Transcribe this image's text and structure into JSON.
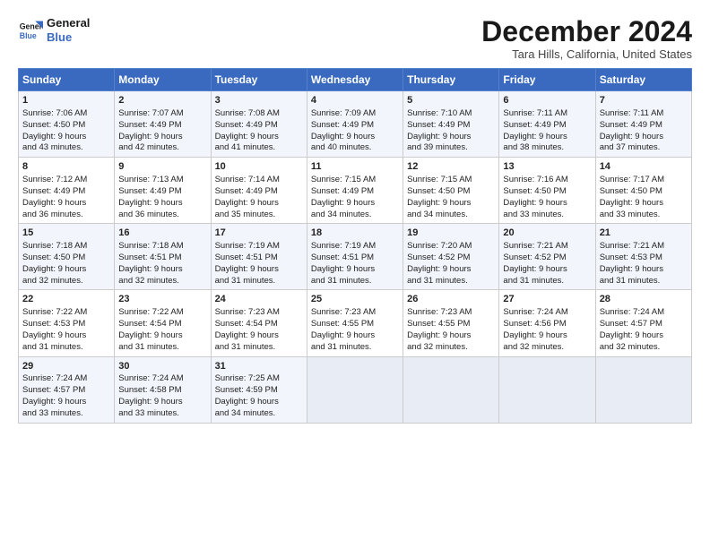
{
  "header": {
    "logo_line1": "General",
    "logo_line2": "Blue",
    "title": "December 2024",
    "subtitle": "Tara Hills, California, United States"
  },
  "days_of_week": [
    "Sunday",
    "Monday",
    "Tuesday",
    "Wednesday",
    "Thursday",
    "Friday",
    "Saturday"
  ],
  "weeks": [
    [
      {
        "day": "1",
        "lines": [
          "Sunrise: 7:06 AM",
          "Sunset: 4:50 PM",
          "Daylight: 9 hours",
          "and 43 minutes."
        ]
      },
      {
        "day": "2",
        "lines": [
          "Sunrise: 7:07 AM",
          "Sunset: 4:49 PM",
          "Daylight: 9 hours",
          "and 42 minutes."
        ]
      },
      {
        "day": "3",
        "lines": [
          "Sunrise: 7:08 AM",
          "Sunset: 4:49 PM",
          "Daylight: 9 hours",
          "and 41 minutes."
        ]
      },
      {
        "day": "4",
        "lines": [
          "Sunrise: 7:09 AM",
          "Sunset: 4:49 PM",
          "Daylight: 9 hours",
          "and 40 minutes."
        ]
      },
      {
        "day": "5",
        "lines": [
          "Sunrise: 7:10 AM",
          "Sunset: 4:49 PM",
          "Daylight: 9 hours",
          "and 39 minutes."
        ]
      },
      {
        "day": "6",
        "lines": [
          "Sunrise: 7:11 AM",
          "Sunset: 4:49 PM",
          "Daylight: 9 hours",
          "and 38 minutes."
        ]
      },
      {
        "day": "7",
        "lines": [
          "Sunrise: 7:11 AM",
          "Sunset: 4:49 PM",
          "Daylight: 9 hours",
          "and 37 minutes."
        ]
      }
    ],
    [
      {
        "day": "8",
        "lines": [
          "Sunrise: 7:12 AM",
          "Sunset: 4:49 PM",
          "Daylight: 9 hours",
          "and 36 minutes."
        ]
      },
      {
        "day": "9",
        "lines": [
          "Sunrise: 7:13 AM",
          "Sunset: 4:49 PM",
          "Daylight: 9 hours",
          "and 36 minutes."
        ]
      },
      {
        "day": "10",
        "lines": [
          "Sunrise: 7:14 AM",
          "Sunset: 4:49 PM",
          "Daylight: 9 hours",
          "and 35 minutes."
        ]
      },
      {
        "day": "11",
        "lines": [
          "Sunrise: 7:15 AM",
          "Sunset: 4:49 PM",
          "Daylight: 9 hours",
          "and 34 minutes."
        ]
      },
      {
        "day": "12",
        "lines": [
          "Sunrise: 7:15 AM",
          "Sunset: 4:50 PM",
          "Daylight: 9 hours",
          "and 34 minutes."
        ]
      },
      {
        "day": "13",
        "lines": [
          "Sunrise: 7:16 AM",
          "Sunset: 4:50 PM",
          "Daylight: 9 hours",
          "and 33 minutes."
        ]
      },
      {
        "day": "14",
        "lines": [
          "Sunrise: 7:17 AM",
          "Sunset: 4:50 PM",
          "Daylight: 9 hours",
          "and 33 minutes."
        ]
      }
    ],
    [
      {
        "day": "15",
        "lines": [
          "Sunrise: 7:18 AM",
          "Sunset: 4:50 PM",
          "Daylight: 9 hours",
          "and 32 minutes."
        ]
      },
      {
        "day": "16",
        "lines": [
          "Sunrise: 7:18 AM",
          "Sunset: 4:51 PM",
          "Daylight: 9 hours",
          "and 32 minutes."
        ]
      },
      {
        "day": "17",
        "lines": [
          "Sunrise: 7:19 AM",
          "Sunset: 4:51 PM",
          "Daylight: 9 hours",
          "and 31 minutes."
        ]
      },
      {
        "day": "18",
        "lines": [
          "Sunrise: 7:19 AM",
          "Sunset: 4:51 PM",
          "Daylight: 9 hours",
          "and 31 minutes."
        ]
      },
      {
        "day": "19",
        "lines": [
          "Sunrise: 7:20 AM",
          "Sunset: 4:52 PM",
          "Daylight: 9 hours",
          "and 31 minutes."
        ]
      },
      {
        "day": "20",
        "lines": [
          "Sunrise: 7:21 AM",
          "Sunset: 4:52 PM",
          "Daylight: 9 hours",
          "and 31 minutes."
        ]
      },
      {
        "day": "21",
        "lines": [
          "Sunrise: 7:21 AM",
          "Sunset: 4:53 PM",
          "Daylight: 9 hours",
          "and 31 minutes."
        ]
      }
    ],
    [
      {
        "day": "22",
        "lines": [
          "Sunrise: 7:22 AM",
          "Sunset: 4:53 PM",
          "Daylight: 9 hours",
          "and 31 minutes."
        ]
      },
      {
        "day": "23",
        "lines": [
          "Sunrise: 7:22 AM",
          "Sunset: 4:54 PM",
          "Daylight: 9 hours",
          "and 31 minutes."
        ]
      },
      {
        "day": "24",
        "lines": [
          "Sunrise: 7:23 AM",
          "Sunset: 4:54 PM",
          "Daylight: 9 hours",
          "and 31 minutes."
        ]
      },
      {
        "day": "25",
        "lines": [
          "Sunrise: 7:23 AM",
          "Sunset: 4:55 PM",
          "Daylight: 9 hours",
          "and 31 minutes."
        ]
      },
      {
        "day": "26",
        "lines": [
          "Sunrise: 7:23 AM",
          "Sunset: 4:55 PM",
          "Daylight: 9 hours",
          "and 32 minutes."
        ]
      },
      {
        "day": "27",
        "lines": [
          "Sunrise: 7:24 AM",
          "Sunset: 4:56 PM",
          "Daylight: 9 hours",
          "and 32 minutes."
        ]
      },
      {
        "day": "28",
        "lines": [
          "Sunrise: 7:24 AM",
          "Sunset: 4:57 PM",
          "Daylight: 9 hours",
          "and 32 minutes."
        ]
      }
    ],
    [
      {
        "day": "29",
        "lines": [
          "Sunrise: 7:24 AM",
          "Sunset: 4:57 PM",
          "Daylight: 9 hours",
          "and 33 minutes."
        ]
      },
      {
        "day": "30",
        "lines": [
          "Sunrise: 7:24 AM",
          "Sunset: 4:58 PM",
          "Daylight: 9 hours",
          "and 33 minutes."
        ]
      },
      {
        "day": "31",
        "lines": [
          "Sunrise: 7:25 AM",
          "Sunset: 4:59 PM",
          "Daylight: 9 hours",
          "and 34 minutes."
        ]
      },
      null,
      null,
      null,
      null
    ]
  ]
}
